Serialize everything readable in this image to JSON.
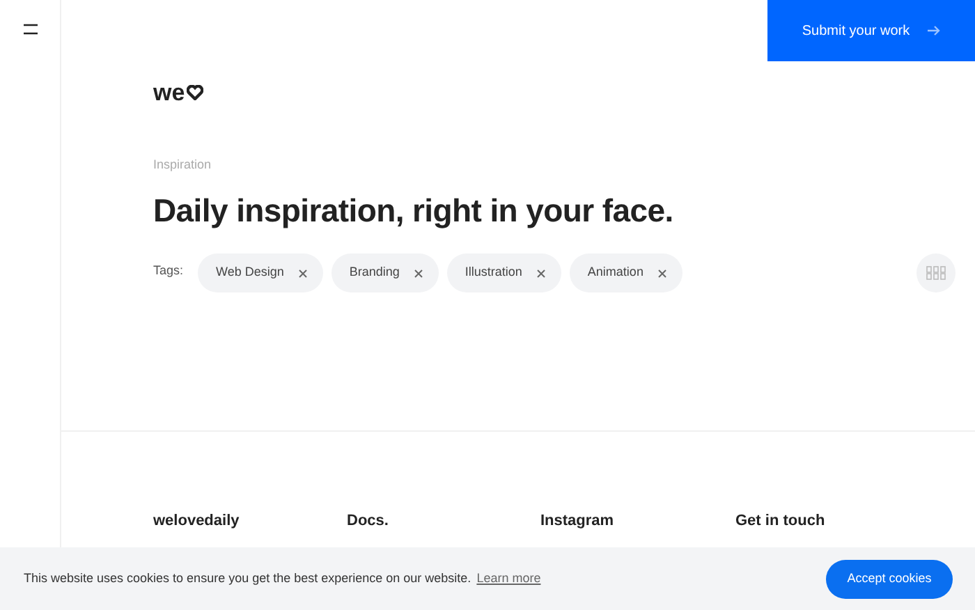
{
  "header": {
    "submit_button": "Submit your work"
  },
  "logo": "we",
  "eyebrow": "Inspiration",
  "headline": "Daily inspiration, right in your face.",
  "tags_label": "Tags:",
  "tags": [
    {
      "label": "Web Design"
    },
    {
      "label": "Branding"
    },
    {
      "label": "Illustration"
    },
    {
      "label": "Animation"
    }
  ],
  "footer": {
    "columns": [
      "welovedaily",
      "Docs.",
      "Instagram",
      "Get in touch"
    ]
  },
  "cookie_bar": {
    "message": "This website uses cookies to ensure you get the best experience on our website.",
    "link": "Learn more",
    "button": "Accept cookies"
  }
}
